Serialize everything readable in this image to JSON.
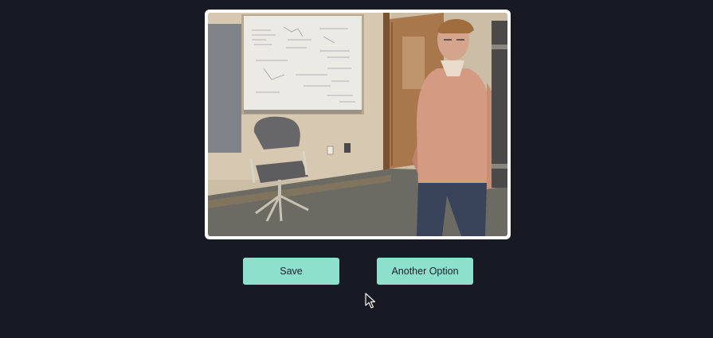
{
  "colors": {
    "background": "#171a24",
    "button_fill": "#8de0cb",
    "button_text": "#1a1f2a",
    "frame": "#ffffff"
  },
  "media": {
    "description_icon": "photo-image"
  },
  "actions": {
    "save_label": "Save",
    "another_label": "Another Option"
  },
  "cursor": {
    "icon": "arrow-pointer-icon"
  }
}
